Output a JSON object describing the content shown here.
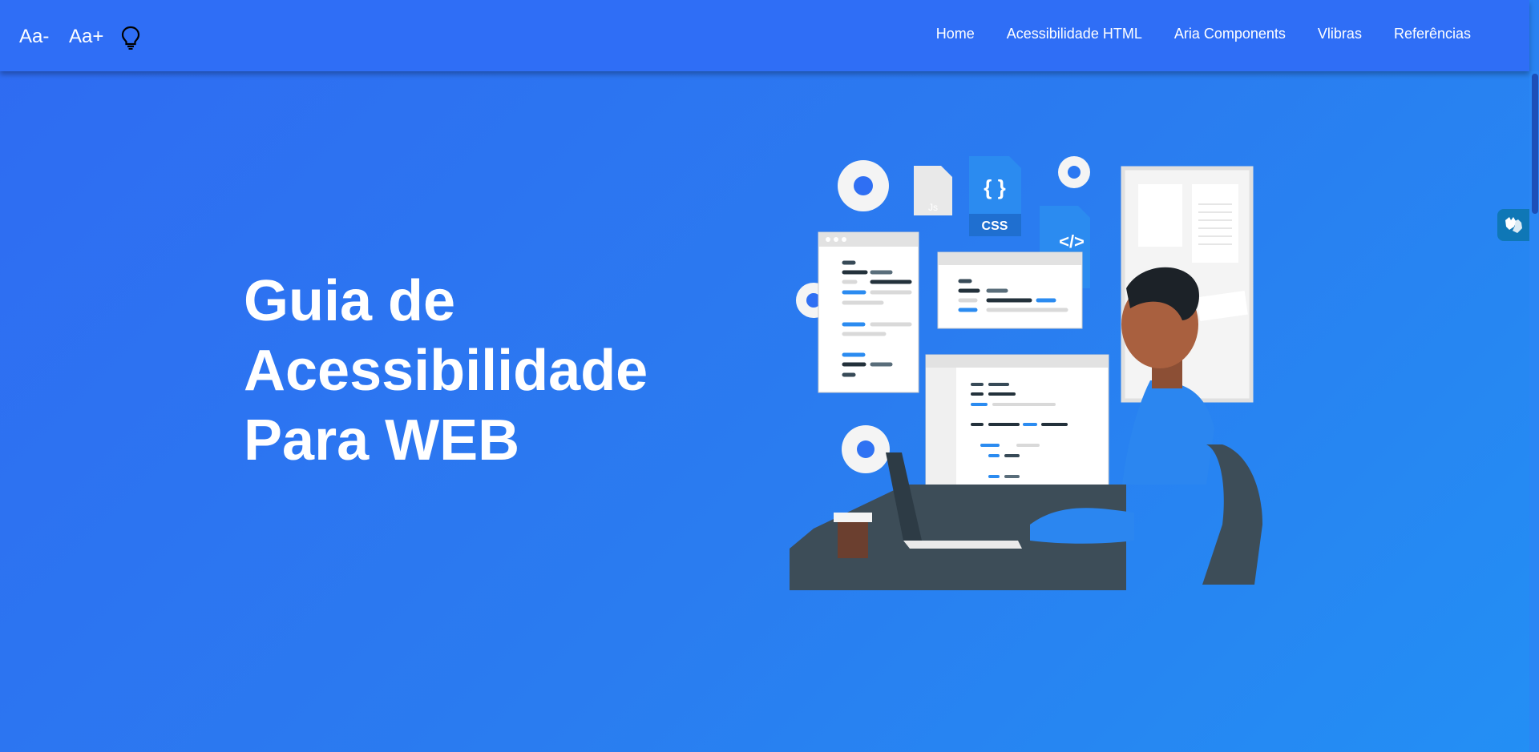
{
  "header": {
    "font_decrease": "Aa-",
    "font_increase": "Aa+",
    "theme_icon": "lightbulb-icon",
    "nav": [
      {
        "label": "Home"
      },
      {
        "label": "Acessibilidade HTML"
      },
      {
        "label": "Aria Components"
      },
      {
        "label": "Vlibras"
      },
      {
        "label": "Referências"
      }
    ]
  },
  "hero": {
    "title_lines": [
      "Guia de",
      "Acessibilidade",
      "Para WEB"
    ],
    "illustration": {
      "file_labels": [
        "Js",
        "CSS",
        "</>",
        "{ }"
      ]
    }
  },
  "vlibras": {
    "icon": "sign-language-hands-icon"
  },
  "colors": {
    "header_bg": "#2f6ef6",
    "page_gradient_start": "#2f6bf2",
    "page_gradient_end": "#238ff4",
    "accent_blue": "#2b8bf0",
    "shirt_blue": "#2b86f0"
  }
}
